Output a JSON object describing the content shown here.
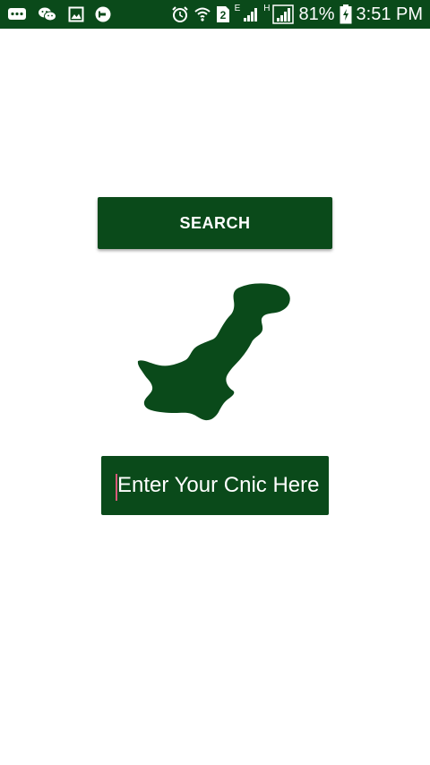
{
  "status_bar": {
    "battery_percent": "81%",
    "time": "3:51 PM",
    "network_e_label": "E",
    "network_h_label": "H",
    "notification_icons": [
      "messages-icon",
      "wechat-icon",
      "gallery-icon",
      "uber-icon"
    ],
    "system_icons": [
      "alarm-icon",
      "wifi-icon",
      "sim2-icon",
      "signal-e-icon",
      "signal-h-icon",
      "battery-charging-icon"
    ],
    "background_color": "#0a4a1a"
  },
  "main": {
    "search_label": "SEARCH",
    "cnic_placeholder": "Enter Your Cnic Here",
    "map_icon": "pakistan-map-icon"
  },
  "colors": {
    "primary_green": "#0a4a1a",
    "background": "#ffffff",
    "text_on_green": "#ffffff"
  }
}
